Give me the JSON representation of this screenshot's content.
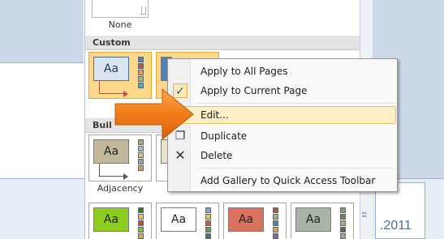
{
  "gallery": {
    "none_label": "None",
    "sections": {
      "custom": "Custom",
      "builtin": "Buil"
    },
    "thumb_text": "Aa",
    "adjacency_label": "Adjacency"
  },
  "context_menu": {
    "items": [
      {
        "label": "Apply to All Pages"
      },
      {
        "label": "Apply to Current Page"
      },
      {
        "label": "Edit..."
      },
      {
        "label": "Duplicate"
      },
      {
        "label": "Delete"
      },
      {
        "label": "Add Gallery to Quick Access Toolbar"
      }
    ]
  },
  "background": {
    "year_text": ".2011"
  },
  "colors": {
    "accent_orange": "#f07d1a",
    "hover": "#fdf0c6",
    "selected_thumb": "#fbd88a"
  }
}
